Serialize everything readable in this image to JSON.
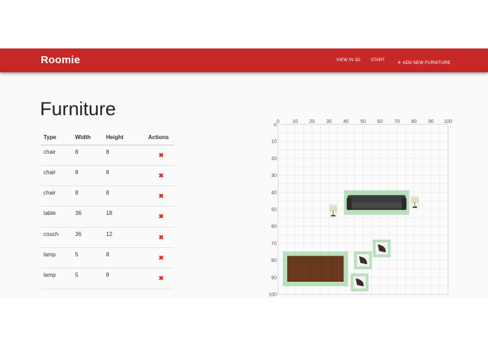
{
  "app": {
    "brand": "Roomie"
  },
  "nav": [
    {
      "label": "VIEW IN 3D"
    },
    {
      "label": "START"
    },
    {
      "label": "ADD NEW FURNITURE",
      "icon": "plus-icon"
    }
  ],
  "page": {
    "title": "Furniture"
  },
  "table": {
    "headers": [
      "Type",
      "Width",
      "Height",
      "Actions"
    ],
    "rows": [
      {
        "type": "chair",
        "width": "8",
        "height": "8"
      },
      {
        "type": "chair",
        "width": "8",
        "height": "8"
      },
      {
        "type": "chair",
        "width": "8",
        "height": "8"
      },
      {
        "type": "table",
        "width": "36",
        "height": "18"
      },
      {
        "type": "couch",
        "width": "36",
        "height": "12"
      },
      {
        "type": "lamp",
        "width": "5",
        "height": "8"
      },
      {
        "type": "lamp",
        "width": "5",
        "height": "8"
      }
    ],
    "delete_icon": "close-icon"
  },
  "colors": {
    "primary": "#c62828",
    "delete": "#d32f2f",
    "highlight": "#a5d6a7"
  },
  "room": {
    "x_ticks": [
      "0",
      "10",
      "20",
      "30",
      "40",
      "50",
      "60",
      "70",
      "80",
      "90",
      "100"
    ],
    "y_ticks": [
      "10",
      "20",
      "30",
      "40",
      "50",
      "60",
      "70",
      "80",
      "90",
      "100"
    ],
    "origin_label": "0",
    "items": [
      {
        "type": "couch",
        "x": 40,
        "y": 40,
        "w": 36,
        "h": 12
      },
      {
        "type": "lamp",
        "x": 30,
        "y": 47,
        "w": 5,
        "h": 8
      },
      {
        "type": "lamp",
        "x": 78,
        "y": 42,
        "w": 5,
        "h": 8
      },
      {
        "type": "table",
        "x": 4,
        "y": 76,
        "w": 36,
        "h": 18
      },
      {
        "type": "chair",
        "x": 46,
        "y": 76,
        "w": 8,
        "h": 8
      },
      {
        "type": "chair",
        "x": 57,
        "y": 69,
        "w": 8,
        "h": 8
      },
      {
        "type": "chair",
        "x": 44,
        "y": 89,
        "w": 8,
        "h": 8
      }
    ]
  }
}
